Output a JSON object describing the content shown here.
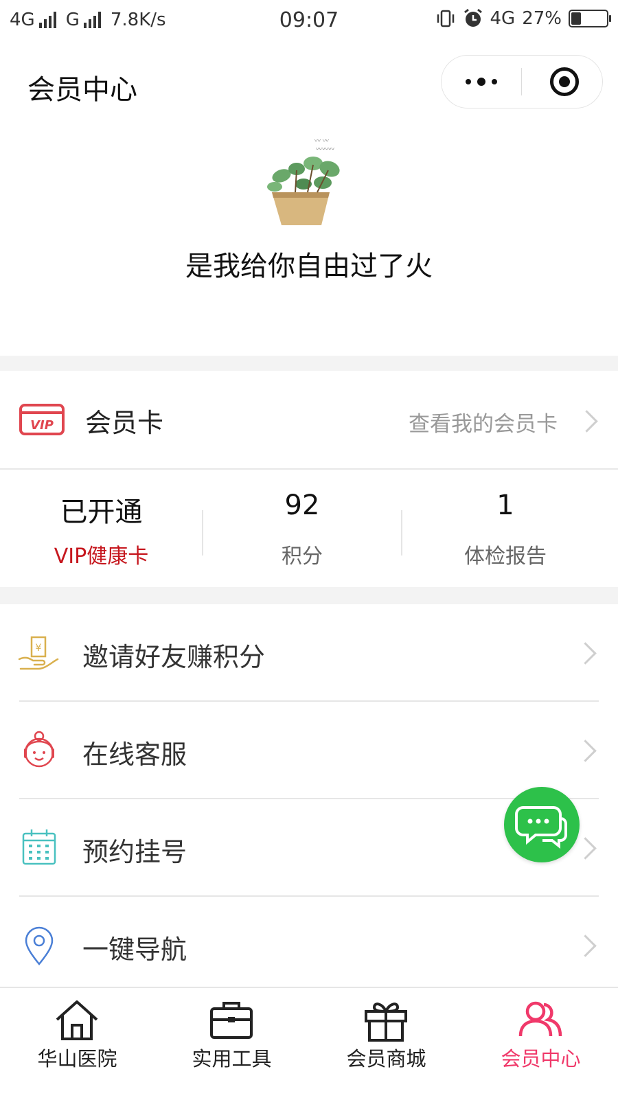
{
  "status_bar": {
    "network1": "4G",
    "network2": "G",
    "speed": "7.8K/s",
    "time": "09:07",
    "network3": "4G",
    "battery": "27%",
    "battery_level": 0.27
  },
  "navbar": {
    "title": "会员中心"
  },
  "profile": {
    "nickname": "是我给你自由过了火"
  },
  "member_card": {
    "label": "会员卡",
    "link_text": "查看我的会员卡",
    "icon_text": "VIP"
  },
  "stats": [
    {
      "value": "已开通",
      "label": "VIP健康卡"
    },
    {
      "value": "92",
      "label": "积分"
    },
    {
      "value": "1",
      "label": "体检报告"
    }
  ],
  "menu": [
    {
      "label": "邀请好友赚积分",
      "icon": "invite-hand-coin-icon"
    },
    {
      "label": "在线客服",
      "icon": "customer-service-icon"
    },
    {
      "label": "预约挂号",
      "icon": "calendar-icon"
    },
    {
      "label": "一键导航",
      "icon": "location-pin-icon"
    }
  ],
  "tabbar": [
    {
      "label": "华山医院",
      "icon": "home-icon"
    },
    {
      "label": "实用工具",
      "icon": "briefcase-icon"
    },
    {
      "label": "会员商城",
      "icon": "gift-icon"
    },
    {
      "label": "会员中心",
      "icon": "users-icon",
      "active": true
    }
  ],
  "colors": {
    "accent_red": "#c6171e",
    "active_tab": "#f0396a",
    "chat_green": "#2dc14a",
    "vip_red": "#e0464f"
  }
}
